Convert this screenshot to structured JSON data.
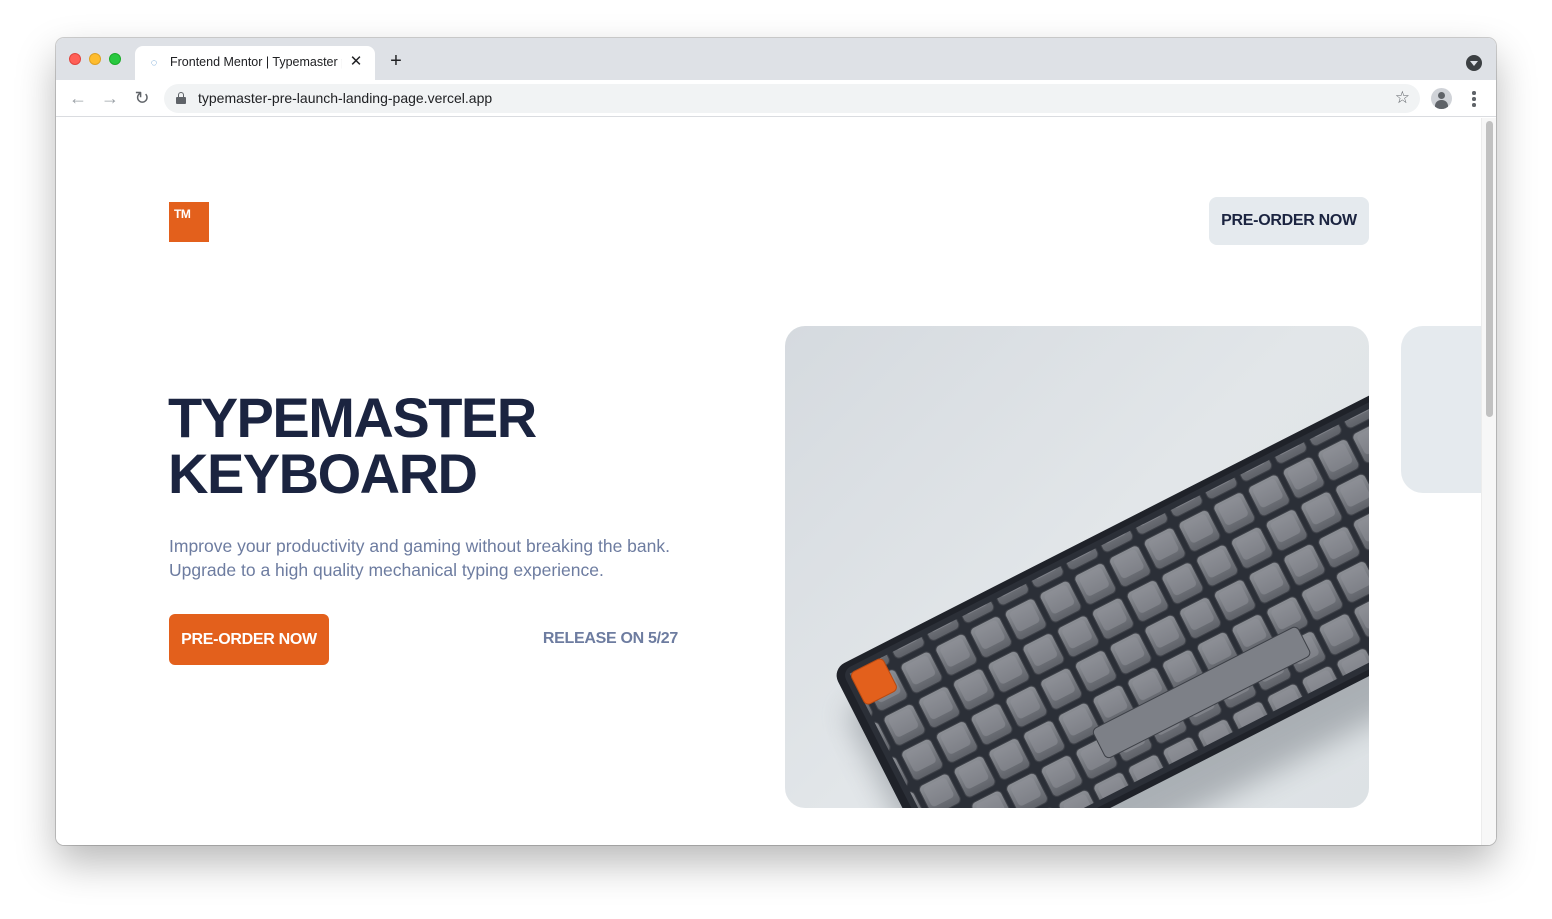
{
  "browser": {
    "tab_title": "Frontend Mentor | Typemaster pre-launch landing page",
    "url": "typemaster-pre-launch-landing-page.vercel.app",
    "icons": {
      "back": "arrow-left-icon",
      "forward": "arrow-right-icon",
      "reload": "reload-icon",
      "lock": "lock-icon",
      "bookmark": "star-icon",
      "profile": "profile-icon",
      "menu": "kebab-menu-icon",
      "new_tab": "plus-icon",
      "close_tab": "close-icon"
    }
  },
  "page": {
    "logo_text": "TM",
    "header_cta_label": "PRE-ORDER NOW",
    "headline": [
      "TYPEMASTER",
      "KEYBOARD"
    ],
    "description": "Improve your productivity and gaming without breaking the bank. Upgrade to a high quality mechanical typing experience.",
    "cta_label": "PRE-ORDER NOW",
    "release_text": "RELEASE ON 5/27",
    "colors": {
      "accent": "#e3601c",
      "dark_navy": "#1b2440",
      "muted_text": "#6d7ca0",
      "light_surface": "#e5eaee"
    }
  }
}
